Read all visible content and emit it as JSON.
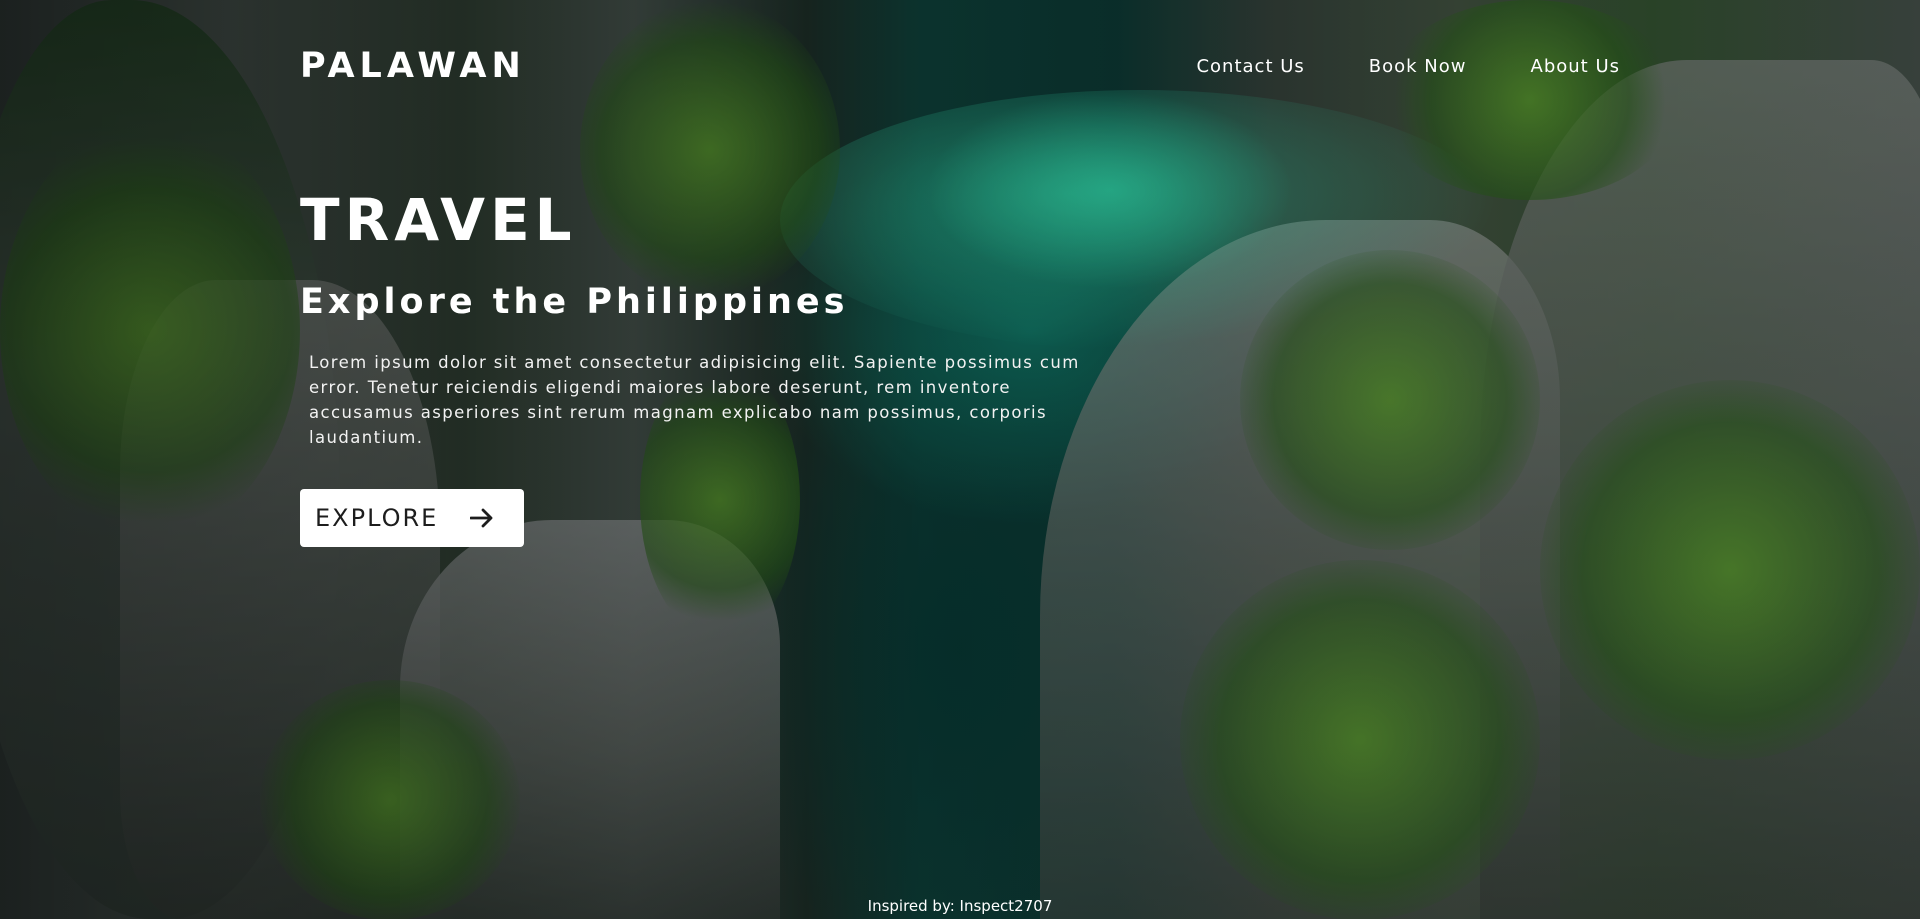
{
  "brand": {
    "logo": "PALAWAN"
  },
  "nav": {
    "items": [
      {
        "label": "Contact Us"
      },
      {
        "label": "Book Now"
      },
      {
        "label": "About Us"
      }
    ]
  },
  "hero": {
    "headline": "TRAVEL",
    "subheadline": "Explore the Philippines",
    "body": "Lorem ipsum dolor sit amet consectetur adipisicing elit. Sapiente possimus cum error. Tenetur reiciendis eligendi maiores labore deserunt, rem inventore accusamus asperiores sint rerum magnam explicabo nam possimus, corporis laudantium.",
    "button": {
      "label": "EXPLORE",
      "icon": "arrow-right-icon"
    }
  },
  "footer": {
    "credit": "Inspired by: Inspect2707"
  },
  "colors": {
    "button_bg": "#ffffff",
    "button_text": "#1d1d1d",
    "text": "#ffffff"
  }
}
